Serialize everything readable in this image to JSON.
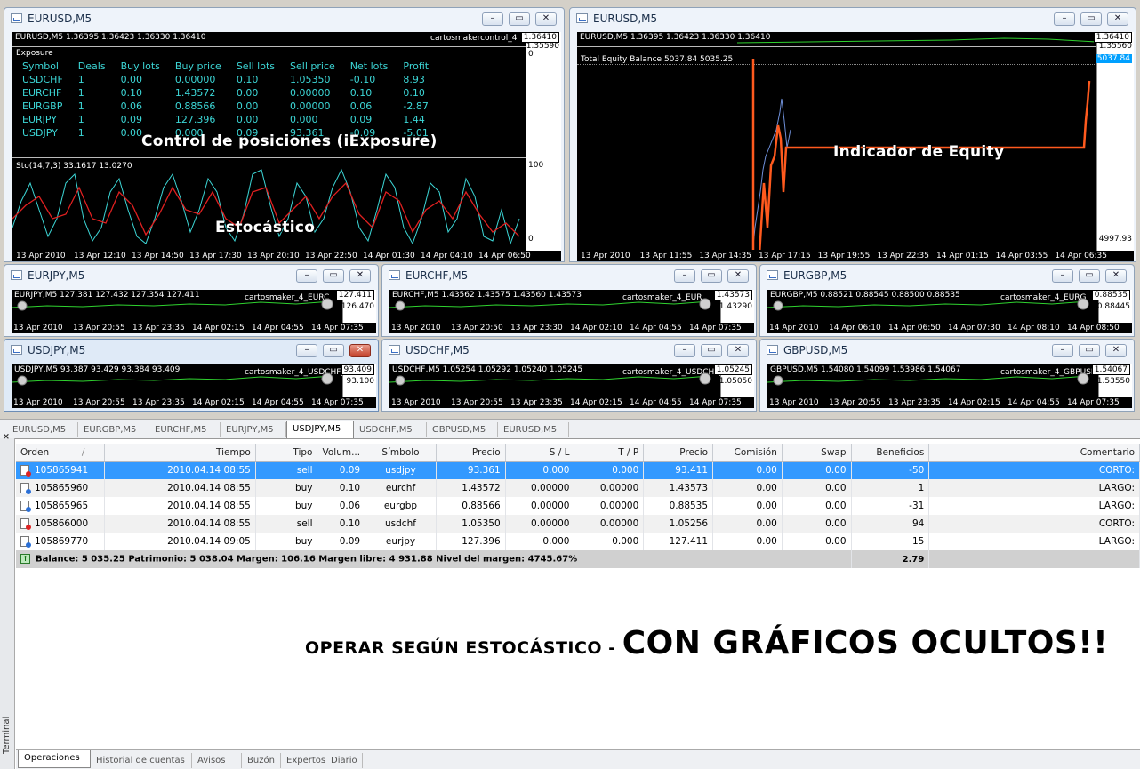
{
  "windows": {
    "w1": {
      "title": "EURUSD,M5",
      "header": "EURUSD,M5 1.36395 1.36423 1.36330 1.36410",
      "indicator": "cartosmakercontrol_4",
      "prices": [
        "1.36410",
        "1.35590"
      ],
      "exposure": {
        "title": "Exposure",
        "columns": [
          "Symbol",
          "Deals",
          "Buy lots",
          "Buy price",
          "Sell lots",
          "Sell price",
          "Net lots",
          "Profit"
        ],
        "rows": [
          [
            "USDCHF",
            "1",
            "0.00",
            "0.00000",
            "0.10",
            "1.05350",
            "-0.10",
            "8.93"
          ],
          [
            "EURCHF",
            "1",
            "0.10",
            "1.43572",
            "0.00",
            "0.00000",
            "0.10",
            "0.10"
          ],
          [
            "EURGBP",
            "1",
            "0.06",
            "0.88566",
            "0.00",
            "0.00000",
            "0.06",
            "-2.87"
          ],
          [
            "EURJPY",
            "1",
            "0.09",
            "127.396",
            "0.00",
            "0.000",
            "0.09",
            "1.44"
          ],
          [
            "USDJPY",
            "1",
            "0.00",
            "0.000",
            "0.09",
            "93.361",
            "-0.09",
            "-5.01"
          ]
        ]
      },
      "overlay_main": "Control de posiciones (iExposure)",
      "sto_header": "Sto(14,7,3) 33.1617 13.0270",
      "sto_axis": [
        "100",
        "0"
      ],
      "axis_zero": "0",
      "overlay_sto": "Estocástico",
      "times": [
        "13 Apr 2010",
        "13 Apr 12:10",
        "13 Apr 14:50",
        "13 Apr 17:30",
        "13 Apr 20:10",
        "13 Apr 22:50",
        "14 Apr 01:30",
        "14 Apr 04:10",
        "14 Apr 06:50"
      ]
    },
    "w2": {
      "title": "EURUSD,M5",
      "header": "EURUSD,M5 1.36395 1.36423 1.36330 1.36410",
      "prices": [
        "1.36410",
        "1.35560"
      ],
      "equity_header": "Total Equity Balance 5037.84 5035.25",
      "equity_prices": [
        "5037.84",
        "4997.93"
      ],
      "overlay": "Indicador de Equity",
      "times": [
        "13 Apr 2010",
        "13 Apr 11:55",
        "13 Apr 14:35",
        "13 Apr 17:15",
        "13 Apr 19:55",
        "13 Apr 22:35",
        "14 Apr 01:15",
        "14 Apr 03:55",
        "14 Apr 06:35"
      ]
    },
    "w3": {
      "title": "EURJPY,M5",
      "header": "EURJPY,M5 127.381 127.432 127.354 127.411",
      "indicator": "cartosmaker_4_EURC",
      "prices": [
        "127.411",
        "126.470"
      ],
      "times": [
        "13 Apr 2010",
        "13 Apr 20:55",
        "13 Apr 23:35",
        "14 Apr 02:15",
        "14 Apr 04:55",
        "14 Apr 07:35"
      ]
    },
    "w4": {
      "title": "EURCHF,M5",
      "header": "EURCHF,M5 1.43562 1.43575 1.43560 1.43573",
      "indicator": "cartosmaker_4_EUR",
      "prices": [
        "1.43573",
        "1.43290"
      ],
      "times": [
        "13 Apr 2010",
        "13 Apr 20:50",
        "13 Apr 23:30",
        "14 Apr 02:10",
        "14 Apr 04:55",
        "14 Apr 07:35"
      ]
    },
    "w5": {
      "title": "EURGBP,M5",
      "header": "EURGBP,M5 0.88521 0.88545 0.88500 0.88535",
      "indicator": "cartosmaker_4_EURG",
      "prices": [
        "0.88535",
        "0.88445"
      ],
      "times": [
        "14 Apr 2010",
        "14 Apr 06:10",
        "14 Apr 06:50",
        "14 Apr 07:30",
        "14 Apr 08:10",
        "14 Apr 08:50"
      ]
    },
    "w6": {
      "title": "USDJPY,M5",
      "header": "USDJPY,M5 93.387 93.429 93.384 93.409",
      "indicator": "cartosmaker_4_USDCHFJPY",
      "prices": [
        "93.409",
        "93.100"
      ],
      "times": [
        "13 Apr 2010",
        "13 Apr 20:55",
        "13 Apr 23:35",
        "14 Apr 02:15",
        "14 Apr 04:55",
        "14 Apr 07:35"
      ]
    },
    "w7": {
      "title": "USDCHF,M5",
      "header": "USDCHF,M5 1.05254 1.05292 1.05240 1.05245",
      "indicator": "cartosmaker_4_USDCHFJPY",
      "prices": [
        "1.05245",
        "1.05050"
      ],
      "times": [
        "13 Apr 2010",
        "13 Apr 20:55",
        "13 Apr 23:35",
        "14 Apr 02:15",
        "14 Apr 04:55",
        "14 Apr 07:35"
      ]
    },
    "w8": {
      "title": "GBPUSD,M5",
      "header": "GBPUSD,M5 1.54080 1.54099 1.53986 1.54067",
      "indicator": "cartosmaker_4_GBPUSD",
      "prices": [
        "1.54067",
        "1.53550"
      ],
      "times": [
        "13 Apr 2010",
        "13 Apr 20:55",
        "13 Apr 23:35",
        "14 Apr 02:15",
        "14 Apr 04:55",
        "14 Apr 07:35"
      ]
    }
  },
  "chart_tabs": [
    "EURUSD,M5",
    "EURGBP,M5",
    "EURCHF,M5",
    "EURJPY,M5",
    "USDJPY,M5",
    "USDCHF,M5",
    "GBPUSD,M5",
    "EURUSD,M5"
  ],
  "terminal": {
    "side_label": "Terminal",
    "close": "×",
    "columns": [
      "Orden",
      "Tiempo",
      "Tipo",
      "Volum...",
      "Símbolo",
      "Precio",
      "S / L",
      "T / P",
      "Precio",
      "Comisión",
      "Swap",
      "Beneficios",
      "Comentario"
    ],
    "sort_mark": "/",
    "rows": [
      {
        "order": "105865941",
        "time": "2010.04.14 08:55",
        "type": "sell",
        "vol": "0.09",
        "sym": "usdjpy",
        "price": "93.361",
        "sl": "0.000",
        "tp": "0.000",
        "cur": "93.411",
        "com": "0.00",
        "swap": "0.00",
        "profit": "-50",
        "comment": "CORTO:"
      },
      {
        "order": "105865960",
        "time": "2010.04.14 08:55",
        "type": "buy",
        "vol": "0.10",
        "sym": "eurchf",
        "price": "1.43572",
        "sl": "0.00000",
        "tp": "0.00000",
        "cur": "1.43573",
        "com": "0.00",
        "swap": "0.00",
        "profit": "1",
        "comment": "LARGO:"
      },
      {
        "order": "105865965",
        "time": "2010.04.14 08:55",
        "type": "buy",
        "vol": "0.06",
        "sym": "eurgbp",
        "price": "0.88566",
        "sl": "0.00000",
        "tp": "0.00000",
        "cur": "0.88535",
        "com": "0.00",
        "swap": "0.00",
        "profit": "-31",
        "comment": "LARGO:"
      },
      {
        "order": "105866000",
        "time": "2010.04.14 08:55",
        "type": "sell",
        "vol": "0.10",
        "sym": "usdchf",
        "price": "1.05350",
        "sl": "0.00000",
        "tp": "0.00000",
        "cur": "1.05256",
        "com": "0.00",
        "swap": "0.00",
        "profit": "94",
        "comment": "CORTO:"
      },
      {
        "order": "105869770",
        "time": "2010.04.14 09:05",
        "type": "buy",
        "vol": "0.09",
        "sym": "eurjpy",
        "price": "127.396",
        "sl": "0.000",
        "tp": "0.000",
        "cur": "127.411",
        "com": "0.00",
        "swap": "0.00",
        "profit": "15",
        "comment": "LARGO:"
      }
    ],
    "balance_line": "Balance: 5 035.25  Patrimonio: 5 038.04  Margen: 106.16  Margen libre: 4 931.88  Nivel del margen: 4745.67%",
    "balance_profit": "2.79",
    "tabs": [
      "Operaciones",
      "Historial de cuentas",
      "Avisos",
      "Buzón",
      "Expertos",
      "Diario"
    ]
  },
  "promo": {
    "small": "OPERAR SEGÚN ESTOCÁSTICO - ",
    "big": "CON GRÁFICOS OCULTOS!!"
  },
  "colors": {
    "chart_bg": "#000000",
    "grid_green": "#2fd22f",
    "stoch_main": "#3cd6d6",
    "stoch_signal": "#e02020",
    "equity": "#ff5a1e",
    "balance_blue": "#6e8fd8",
    "selected_row": "#3399ff"
  },
  "icons": {
    "minimize": "–",
    "maximize": "▭",
    "close": "✕"
  }
}
